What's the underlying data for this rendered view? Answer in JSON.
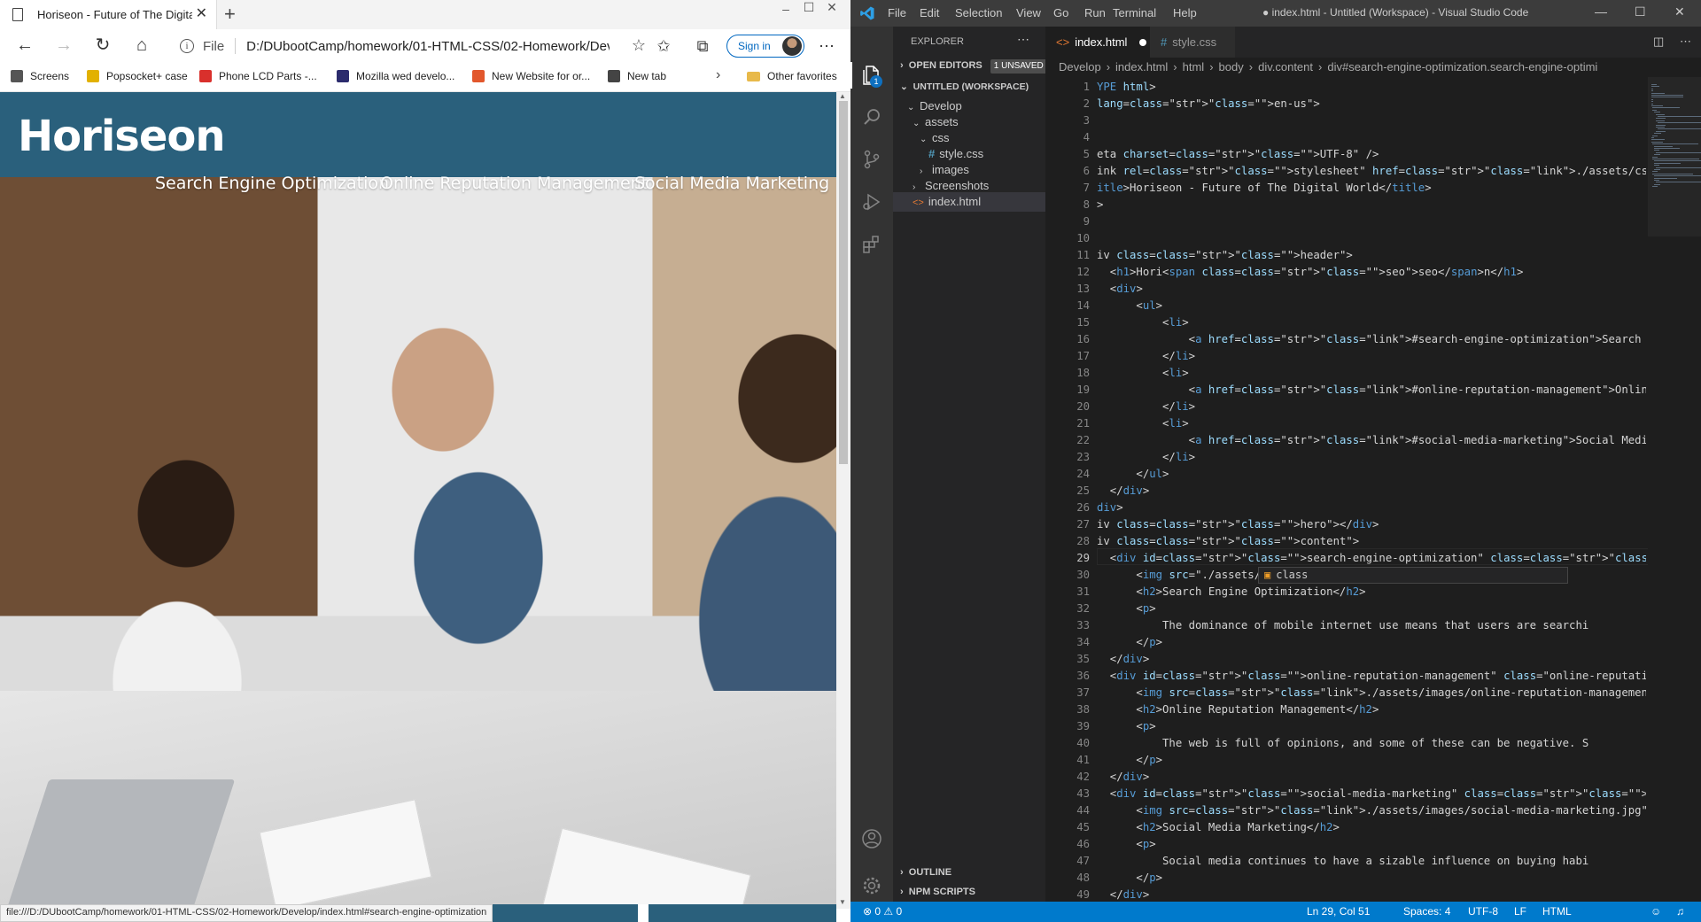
{
  "browser": {
    "tab_title": "Horiseon - Future of The Digital World",
    "address_scheme": "File",
    "address_url": "D:/DUbootCamp/homework/01-HTML-CSS/02-Homework/Develop/index.html",
    "signin_label": "Sign in",
    "favorites": [
      {
        "label": "Screens",
        "icon": "document-icon",
        "color": "#555555"
      },
      {
        "label": "Popsocket+ case",
        "icon": "popsocket-icon",
        "color": "#e2b100"
      },
      {
        "label": "Phone LCD Parts -...",
        "icon": "phone-parts-icon",
        "color": "#d9302c"
      },
      {
        "label": "Mozilla wed develo...",
        "icon": "mozilla-icon",
        "color": "#2b2b6d"
      },
      {
        "label": "New Website for or...",
        "icon": "website-icon",
        "color": "#e2572c"
      },
      {
        "label": "New tab",
        "icon": "newtab-icon",
        "color": "#444444"
      }
    ],
    "other_favorites": "Other favorites",
    "status_url": "file:///D:/DUbootCamp/homework/01-HTML-CSS/02-Homework/Develop/index.html#search-engine-optimization",
    "site": {
      "logo": "Horiseon",
      "nav": [
        "Search Engine Optimization",
        "Online Reputation Management",
        "Social Media Marketing"
      ],
      "header_color": "#2a607c"
    }
  },
  "vscode": {
    "menu": [
      "File",
      "Edit",
      "Selection",
      "View",
      "Go",
      "Run",
      "Terminal",
      "Help"
    ],
    "window_title": "● index.html - Untitled (Workspace) - Visual Studio Code",
    "explorer_title": "EXPLORER",
    "open_editors": "OPEN EDITORS",
    "unsaved_badge": "1 UNSAVED",
    "workspace": "UNTITLED (WORKSPACE)",
    "tree": [
      {
        "label": "Develop",
        "chev": "⌄"
      },
      {
        "label": "assets",
        "chev": "⌄"
      },
      {
        "label": "css",
        "chev": "⌄"
      },
      {
        "label": "style.css",
        "chev": ""
      },
      {
        "label": "images",
        "chev": "›"
      },
      {
        "label": "Screenshots",
        "chev": "›"
      },
      {
        "label": "index.html",
        "chev": ""
      }
    ],
    "outline": "OUTLINE",
    "npm_scripts": "NPM SCRIPTS",
    "activity_badge": "1",
    "tabs": [
      {
        "label": "index.html",
        "active": true
      },
      {
        "label": "style.css",
        "active": false
      }
    ],
    "breadcrumbs": [
      "Develop",
      "index.html",
      "html",
      "body",
      "div.content",
      "div#search-engine-optimization.search-engine-optimi"
    ],
    "code_lines": [
      "YPE html>",
      "lang=\"en-us\">",
      "",
      "",
      "eta charset=\"UTF-8\" />",
      "ink rel=\"stylesheet\" href=\"./assets/css/style.css\">",
      "itle>Horiseon - Future of The Digital World</title>",
      ">",
      "",
      "",
      "iv class=\"header\">",
      "  <h1>Hori<span class=\"seo\">seo</span>n</h1>",
      "  <div>",
      "      <ul>",
      "          <li>",
      "              <a href=\"#search-engine-optimization\">Search Engine Optimizat",
      "          </li>",
      "          <li>",
      "              <a href=\"#online-reputation-management\">Online Reputation Man",
      "          </li>",
      "          <li>",
      "              <a href=\"#social-media-marketing\">Social Media Marketing</a>",
      "          </li>",
      "      </ul>",
      "  </div>",
      "div>",
      "iv class=\"hero\"></div>",
      "iv class=\"content\">",
      "  <div id=\"search-engine-optimization\" class=\"search-engine-optimization\">",
      "      <img src=\"./assets/image",
      "      <h2>Search Engine Optimization</h2>",
      "      <p>",
      "          The dominance of mobile internet use means that users are searchi",
      "      </p>",
      "  </div>",
      "  <div id=\"online-reputation-management\" class=\"online-reputation-managemen",
      "      <img src=\"./assets/images/online-reputation-management.jpg\" class=\"fl",
      "      <h2>Online Reputation Management</h2>",
      "      <p>",
      "          The web is full of opinions, and some of these can be negative. S",
      "      </p>",
      "  </div>",
      "  <div id=\"social-media-marketing\" class=\"social-media-marketing\">",
      "      <img src=\"./assets/images/social-media-marketing.jpg\" class=\"float-le",
      "      <h2>Social Media Marketing</h2>",
      "      <p>",
      "          Social media continues to have a sizable influence on buying habi",
      "      </p>",
      "  </div>"
    ],
    "suggestion": "class",
    "status": {
      "problems": "⊗ 0 ⚠ 0",
      "position": "Ln 29, Col 51",
      "spaces": "Spaces: 4",
      "encoding": "UTF-8",
      "eol": "LF",
      "language": "HTML"
    }
  }
}
